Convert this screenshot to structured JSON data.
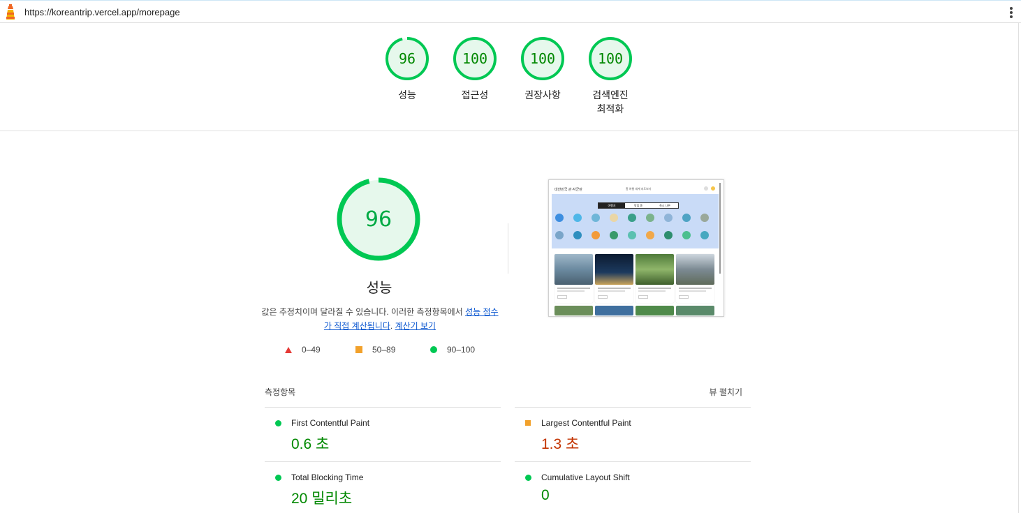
{
  "browser": {
    "url": "https://koreantrip.vercel.app/morepage"
  },
  "summary_gauges": [
    {
      "score": "96",
      "label": "성능"
    },
    {
      "score": "100",
      "label": "접근성"
    },
    {
      "score": "100",
      "label": "권장사항"
    },
    {
      "score": "100",
      "label_line1": "검색엔진",
      "label_line2": "최적화"
    }
  ],
  "performance": {
    "score": "96",
    "title": "성능",
    "description_prefix": "값은 추정치이며 달라질 수 있습니다. 이러한 측정항목에서 ",
    "description_link1": "성능 점수가 직접 계산됩니다",
    "description_mid": ". ",
    "description_link2": "계산기 보기"
  },
  "legend": [
    {
      "range": "0–49",
      "shape": "triangle",
      "color": "#e53935"
    },
    {
      "range": "50–89",
      "shape": "square",
      "color": "#f2a12b"
    },
    {
      "range": "90–100",
      "shape": "circle",
      "color": "#00c853"
    }
  ],
  "metrics_section": {
    "title": "측정항목",
    "expand_label": "뷰 펼치기"
  },
  "metrics": [
    {
      "name": "First Contentful Paint",
      "value": "0.6 초",
      "rating": "good"
    },
    {
      "name": "Largest Contentful Paint",
      "value": "1.3 초",
      "rating": "average"
    },
    {
      "name": "Total Blocking Time",
      "value": "20 밀리초",
      "rating": "good"
    },
    {
      "name": "Cumulative Layout Shift",
      "value": "0",
      "rating": "good"
    }
  ],
  "thumbnail": {
    "brand": "대한민국 관·자군란",
    "nav": "홈   여행   세계 지도보기",
    "tabs": [
      "여행지",
      "맛집 종",
      "축소 나른"
    ]
  },
  "colors": {
    "good": "#00c853",
    "good_text": "#008800",
    "average": "#f2a12b",
    "average_text": "#c33300",
    "poor": "#e53935",
    "link": "#0b57d0"
  }
}
